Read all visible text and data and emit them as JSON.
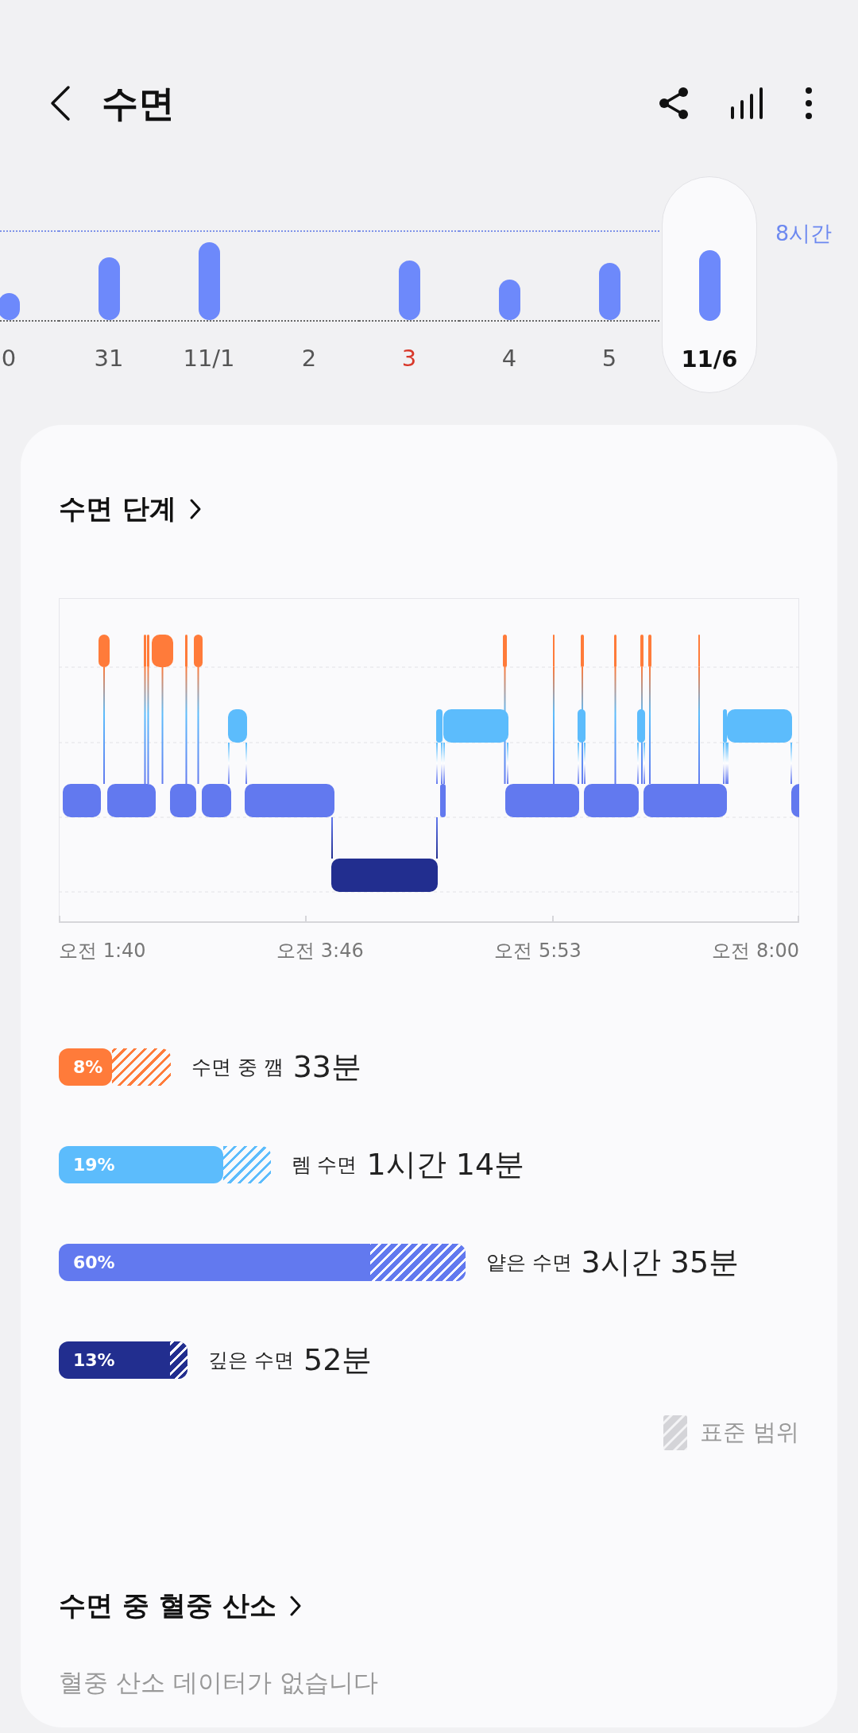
{
  "header": {
    "title": "수면"
  },
  "week": {
    "goal_label": "8시간",
    "days": [
      {
        "label": "0",
        "selected": false,
        "color": "#555555"
      },
      {
        "label": "31",
        "selected": false,
        "color": "#555555"
      },
      {
        "label": "11/1",
        "selected": false,
        "color": "#555555"
      },
      {
        "label": "2",
        "selected": false,
        "color": "#555555"
      },
      {
        "label": "3",
        "selected": false,
        "color": "#d8382a"
      },
      {
        "label": "4",
        "selected": false,
        "color": "#555555"
      },
      {
        "label": "5",
        "selected": false,
        "color": "#555555"
      },
      {
        "label": "11/6",
        "selected": true,
        "color": "#111111"
      }
    ]
  },
  "sleep_stages": {
    "title": "수면 단계",
    "x_labels": [
      "오전 1:40",
      "오전 3:46",
      "오전 5:53",
      "오전 8:00"
    ],
    "stages": [
      {
        "percent": "8%",
        "label": "수면 중 깸",
        "duration": "33분",
        "color": "#ff7b3a"
      },
      {
        "percent": "19%",
        "label": "렘 수면",
        "duration": "1시간 14분",
        "color": "#5cbcfc"
      },
      {
        "percent": "60%",
        "label": "얕은 수면",
        "duration": "3시간 35분",
        "color": "#6279ef"
      },
      {
        "percent": "13%",
        "label": "깊은 수면",
        "duration": "52분",
        "color": "#222e8f"
      }
    ],
    "legend": "표준 범위"
  },
  "blood_oxygen": {
    "title": "수면 중 혈중 산소",
    "message": "혈중 산소 데이터가 없습니다"
  }
}
